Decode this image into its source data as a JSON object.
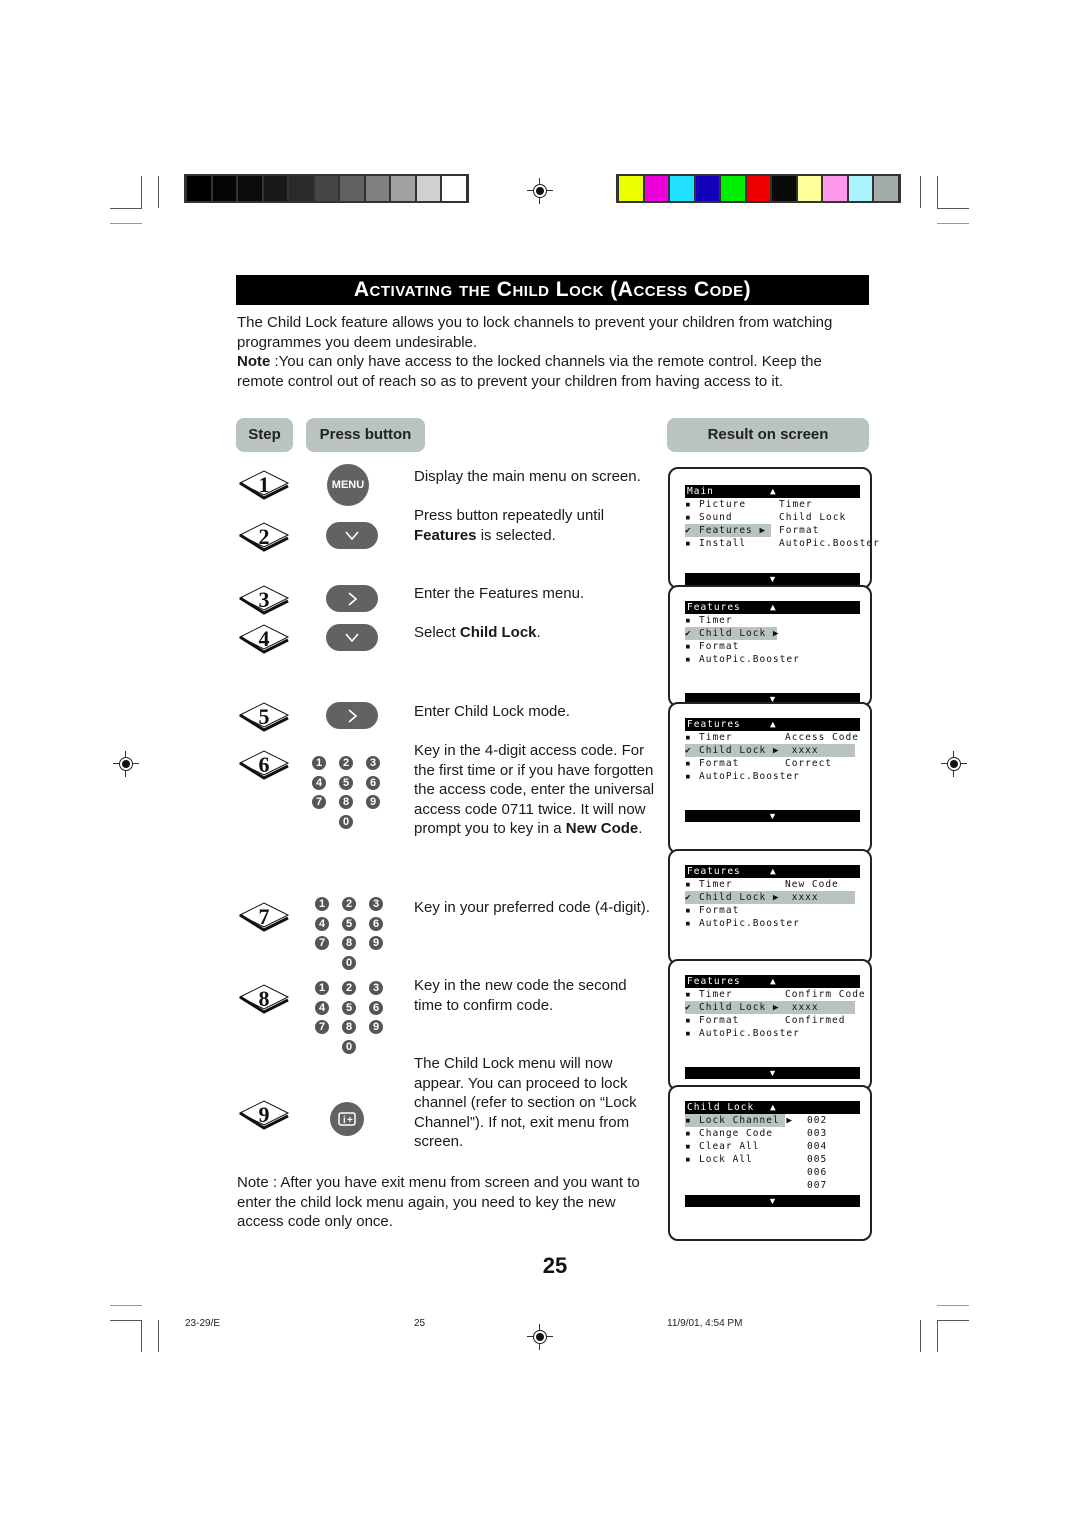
{
  "color_bars": {
    "grayscale": [
      "#000000",
      "#050505",
      "#0c0c0c",
      "#181818",
      "#2a2a2a",
      "#454545",
      "#616161",
      "#808080",
      "#a2a2a2",
      "#d0d0d0",
      "#ffffff"
    ],
    "colors": [
      "#eaff00",
      "#ee00dd",
      "#22e0ff",
      "#1200bb",
      "#00ee00",
      "#ee0000",
      "#0a0a0a",
      "#ffff99",
      "#ff99ee",
      "#aaf4ff",
      "#a2adab"
    ]
  },
  "title": {
    "text": "Activating the Child Lock (Access Code)"
  },
  "intro": {
    "paragraph": "The Child Lock feature allows you to lock channels to prevent your children from watching programmes you deem undesirable.",
    "note_label": "Note",
    "note_text": " :You can only have access to the locked channels via the remote control. Keep the remote control out of reach so as to prevent your children from having access to it."
  },
  "headers": {
    "step": "Step",
    "press_button": "Press button",
    "result": "Result on screen"
  },
  "steps": [
    {
      "num": "1",
      "button": "MENU",
      "text": "Display the main menu on screen."
    },
    {
      "num": "2",
      "button": "down",
      "text_pre": "Press button repeatedly until ",
      "text_bold": "Features",
      "text_post": " is selected."
    },
    {
      "num": "3",
      "button": "right",
      "text": "Enter the Features menu."
    },
    {
      "num": "4",
      "button": "down",
      "text_pre": "Select ",
      "text_bold": "Child Lock",
      "text_post": "."
    },
    {
      "num": "5",
      "button": "right",
      "text": "Enter Child Lock mode."
    },
    {
      "num": "6",
      "button": "keypad",
      "text_pre": "Key in the 4-digit access code. For the first time or if you have forgotten the access code, enter the universal access code 0711 twice. It will now prompt you to key in a ",
      "text_bold": "New Code",
      "text_post": "."
    },
    {
      "num": "7",
      "button": "keypad",
      "text": "Key in your preferred code (4-digit)."
    },
    {
      "num": "8",
      "button": "keypad",
      "text": "Key in the new code the second time to confirm code."
    },
    {
      "num": "9",
      "button": "info",
      "text": "The Child Lock menu will now appear. You can proceed to lock channel (refer to section on “Lock Channel”). If not, exit menu from screen."
    }
  ],
  "keypad_keys": [
    "1",
    "2",
    "3",
    "4",
    "5",
    "6",
    "7",
    "8",
    "9",
    "0"
  ],
  "screens": [
    {
      "title": "Main",
      "rows": [
        {
          "bullet": "▪",
          "label": "Picture",
          "right": "Timer",
          "selected": false
        },
        {
          "bullet": "▪",
          "label": "Sound",
          "right": "Child Lock",
          "selected": false
        },
        {
          "bullet": "✔",
          "label": "Features ▶",
          "right": "Format",
          "selected": true
        },
        {
          "bullet": "▪",
          "label": "Install",
          "right": "AutoPic.Booster",
          "selected": false
        }
      ]
    },
    {
      "title": "Features",
      "rows": [
        {
          "bullet": "▪",
          "label": "Timer",
          "right": "",
          "selected": false
        },
        {
          "bullet": "✔",
          "label": "Child Lock ▶",
          "right": "",
          "selected": true
        },
        {
          "bullet": "▪",
          "label": "Format",
          "right": "",
          "selected": false
        },
        {
          "bullet": "▪",
          "label": "AutoPic.Booster",
          "right": "",
          "selected": false
        }
      ]
    },
    {
      "title": "Features",
      "rows": [
        {
          "bullet": "▪",
          "label": "Timer",
          "right": "Access Code",
          "selected": false
        },
        {
          "bullet": "✔",
          "label": "Child Lock ▶",
          "right": " xxxx",
          "selected": true
        },
        {
          "bullet": "▪",
          "label": "Format",
          "right": "Correct",
          "selected": false
        },
        {
          "bullet": "▪",
          "label": "AutoPic.Booster",
          "right": "",
          "selected": false
        }
      ]
    },
    {
      "title": "Features",
      "rows": [
        {
          "bullet": "▪",
          "label": "Timer",
          "right": "New Code",
          "selected": false
        },
        {
          "bullet": "✔",
          "label": "Child Lock ▶",
          "right": " xxxx",
          "selected": true
        },
        {
          "bullet": "▪",
          "label": "Format",
          "right": "",
          "selected": false
        },
        {
          "bullet": "▪",
          "label": "AutoPic.Booster",
          "right": "",
          "selected": false
        }
      ]
    },
    {
      "title": "Features",
      "rows": [
        {
          "bullet": "▪",
          "label": "Timer",
          "right": "Confirm Code",
          "selected": false
        },
        {
          "bullet": "✔",
          "label": "Child Lock ▶",
          "right": " xxxx",
          "selected": true
        },
        {
          "bullet": "▪",
          "label": "Format",
          "right": "Confirmed",
          "selected": false
        },
        {
          "bullet": "▪",
          "label": "AutoPic.Booster",
          "right": "",
          "selected": false
        }
      ]
    },
    {
      "title": "Child Lock",
      "rows": [
        {
          "bullet": "▪",
          "label": "Lock Channel ▶",
          "right": "002",
          "selected": true
        },
        {
          "bullet": "▪",
          "label": "Change Code",
          "right": "003",
          "selected": false
        },
        {
          "bullet": "▪",
          "label": "Clear All",
          "right": "004",
          "selected": false
        },
        {
          "bullet": "▪",
          "label": "Lock All",
          "right": "005",
          "selected": false
        },
        {
          "bullet": "",
          "label": "",
          "right": "006",
          "selected": false
        },
        {
          "bullet": "",
          "label": "",
          "right": "007",
          "selected": false
        }
      ]
    }
  ],
  "menu_arrows": {
    "up": "▲",
    "down": "▼"
  },
  "bottom_note": "Note : After you have exit menu from screen and you want to enter the child lock menu again, you need to key the new access code only once.",
  "page_number": "25",
  "footer": {
    "left": "23-29/E",
    "center": "25",
    "right": "11/9/01, 4:54 PM"
  }
}
